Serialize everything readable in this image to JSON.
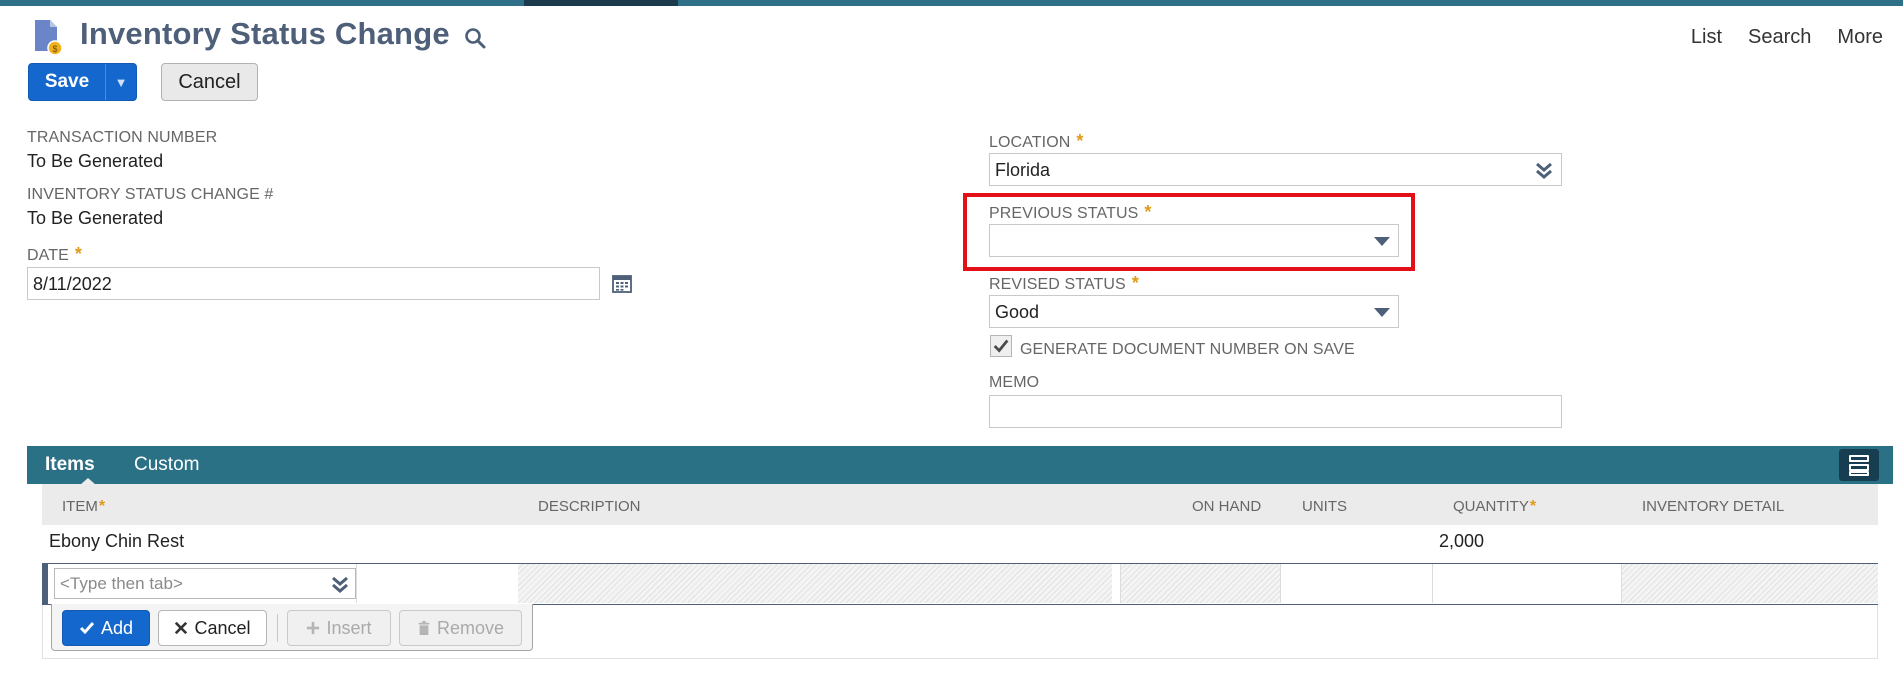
{
  "header": {
    "title": "Inventory Status Change",
    "links": [
      "List",
      "Search",
      "More"
    ]
  },
  "toolbar": {
    "save_label": "Save",
    "cancel_label": "Cancel"
  },
  "form": {
    "transaction_number": {
      "label": "TRANSACTION NUMBER",
      "value": "To Be Generated"
    },
    "status_change_number": {
      "label": "INVENTORY STATUS CHANGE #",
      "value": "To Be Generated"
    },
    "date": {
      "label": "DATE",
      "value": "8/11/2022"
    },
    "location": {
      "label": "LOCATION",
      "value": "Florida"
    },
    "previous_status": {
      "label": "PREVIOUS STATUS",
      "value": ""
    },
    "revised_status": {
      "label": "REVISED STATUS",
      "value": "Good"
    },
    "generate_doc": {
      "label": "GENERATE DOCUMENT NUMBER ON SAVE",
      "checked": true
    },
    "memo": {
      "label": "MEMO",
      "value": ""
    },
    "required_marker": "*"
  },
  "tabs": [
    {
      "label": "Items",
      "active": true
    },
    {
      "label": "Custom",
      "active": false
    }
  ],
  "grid": {
    "columns": [
      "ITEM",
      "DESCRIPTION",
      "ON HAND",
      "UNITS",
      "QUANTITY",
      "INVENTORY DETAIL"
    ],
    "rows": [
      {
        "item": "Ebony Chin Rest",
        "description": "",
        "on_hand": "",
        "units": "",
        "quantity": "2,000",
        "inventory_detail": ""
      }
    ],
    "item_placeholder": "<Type then tab>"
  },
  "row_buttons": {
    "add": "Add",
    "cancel": "Cancel",
    "insert": "Insert",
    "remove": "Remove"
  },
  "colors": {
    "accent": "#2b7186",
    "primary_button": "#1467cc",
    "required": "#e09b1a",
    "highlight": "#e3101a"
  },
  "icons": {
    "title": "document-coin-icon",
    "search": "search-icon",
    "calendar": "calendar-icon",
    "dropdown": "chevron-down-icon",
    "popup": "double-chevron-icon",
    "layout": "layout-toggle-icon"
  }
}
